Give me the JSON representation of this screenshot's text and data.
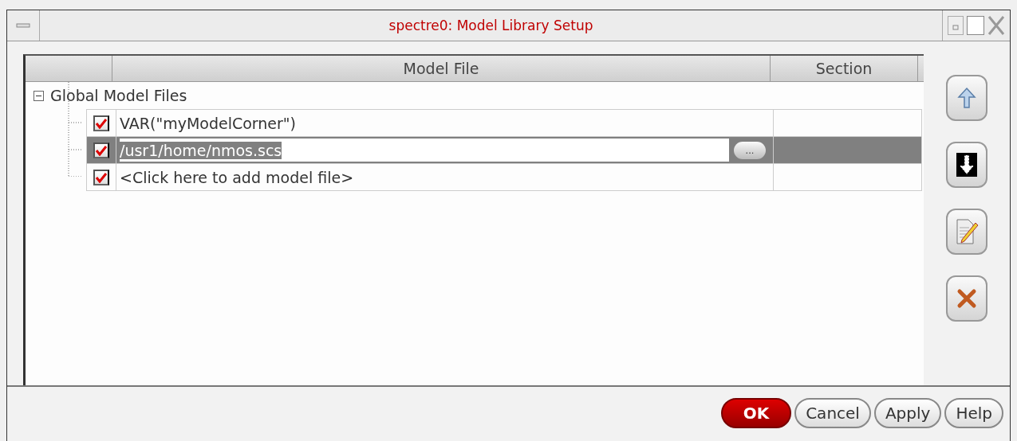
{
  "window": {
    "title": "spectre0: Model Library Setup"
  },
  "table": {
    "columns": [
      "Model File",
      "Section"
    ],
    "group": {
      "label": "Global Model Files",
      "expanded": true,
      "rows": [
        {
          "checked": true,
          "selected": false,
          "model_file": "VAR(\"myModelCorner\")"
        },
        {
          "checked": true,
          "selected": true,
          "model_file": "/usr1/home/nmos.scs",
          "browse_button": "..."
        },
        {
          "checked": true,
          "selected": false,
          "model_file": "<Click here to add model file>"
        }
      ]
    }
  },
  "side_buttons": [
    {
      "kind": "up"
    },
    {
      "kind": "down"
    },
    {
      "kind": "edit"
    },
    {
      "kind": "delete"
    }
  ],
  "buttons": [
    {
      "label": "OK",
      "kind": "default"
    },
    {
      "label": "Cancel",
      "kind": "normal"
    },
    {
      "label": "Apply",
      "kind": "normal"
    },
    {
      "label": "Help",
      "kind": "normal"
    }
  ]
}
